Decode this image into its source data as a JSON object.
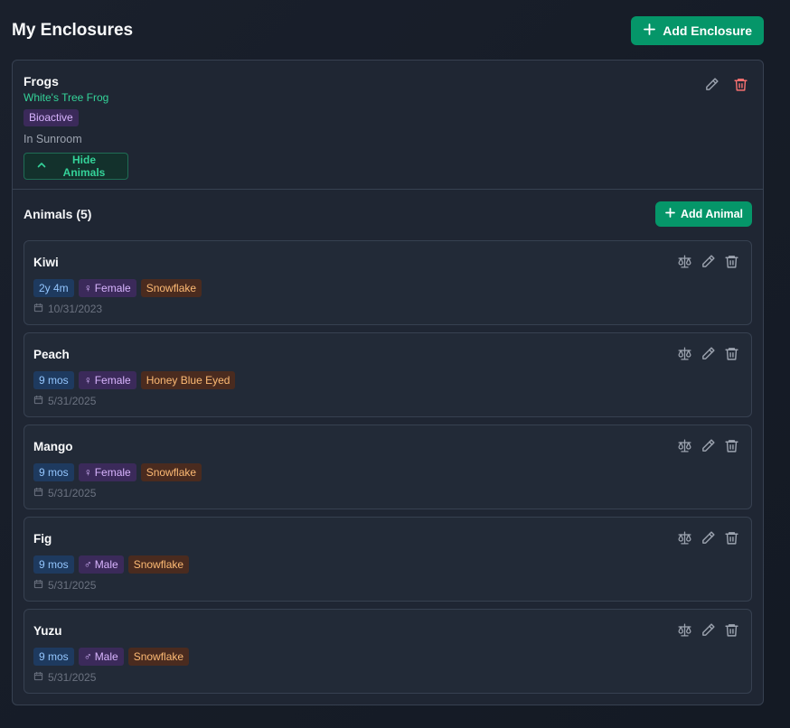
{
  "header": {
    "title": "My Enclosures",
    "add_enclosure_label": "Add Enclosure"
  },
  "enclosure": {
    "name": "Frogs",
    "species": "White's Tree Frog",
    "badge": "Bioactive",
    "location": "In Sunroom",
    "toggle_label": "Hide Animals"
  },
  "animals_section": {
    "title": "Animals (5)",
    "add_animal_label": "Add Animal"
  },
  "animals": [
    {
      "name": "Kiwi",
      "age": "2y 4m",
      "sex": "Female",
      "sex_symbol": "♀",
      "morph": "Snowflake",
      "date": "10/31/2023"
    },
    {
      "name": "Peach",
      "age": "9 mos",
      "sex": "Female",
      "sex_symbol": "♀",
      "morph": "Honey Blue Eyed",
      "date": "5/31/2025"
    },
    {
      "name": "Mango",
      "age": "9 mos",
      "sex": "Female",
      "sex_symbol": "♀",
      "morph": "Snowflake",
      "date": "5/31/2025"
    },
    {
      "name": "Fig",
      "age": "9 mos",
      "sex": "Male",
      "sex_symbol": "♂",
      "morph": "Snowflake",
      "date": "5/31/2025"
    },
    {
      "name": "Yuzu",
      "age": "9 mos",
      "sex": "Male",
      "sex_symbol": "♂",
      "morph": "Snowflake",
      "date": "5/31/2025"
    }
  ],
  "colors": {
    "accent": "#059669",
    "accent_text": "#34d399",
    "danger": "#f87171"
  }
}
